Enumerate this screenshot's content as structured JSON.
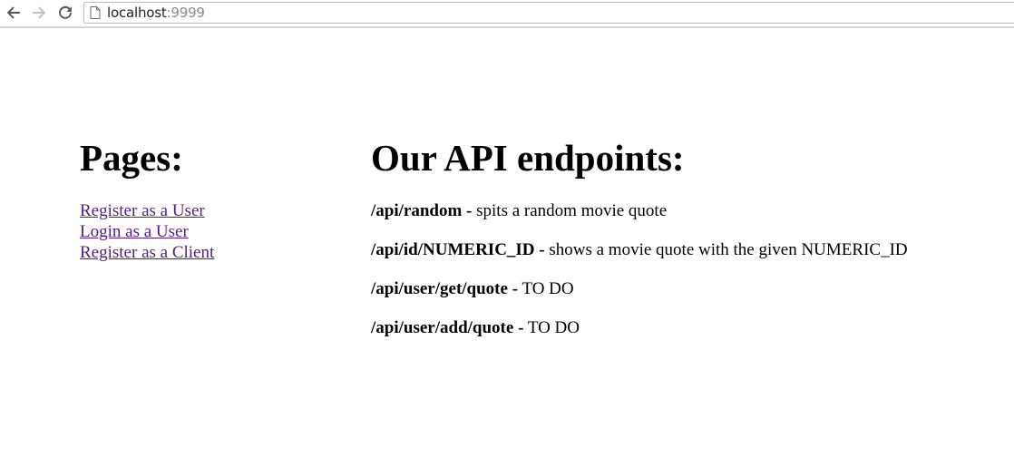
{
  "browser": {
    "url_host": "localhost",
    "url_port": ":9999",
    "icons": {
      "back": "arrow-left-icon",
      "forward": "arrow-right-icon",
      "reload": "reload-icon",
      "page": "page-icon"
    }
  },
  "left": {
    "heading": "Pages:",
    "links": [
      {
        "label": "Register as a User"
      },
      {
        "label": "Login as a User"
      },
      {
        "label": "Register as a Client"
      }
    ],
    "link_color": "#551a8b"
  },
  "right": {
    "heading": "Our API endpoints:",
    "endpoints": [
      {
        "path": "/api/random -",
        "desc": " spits a random movie quote"
      },
      {
        "path": "/api/id/NUMERIC_ID -",
        "desc": " shows a movie quote with the given NUMERIC_ID"
      },
      {
        "path": "/api/user/get/quote -",
        "desc": " TO DO"
      },
      {
        "path": "/api/user/add/quote -",
        "desc": " TO DO"
      }
    ]
  }
}
